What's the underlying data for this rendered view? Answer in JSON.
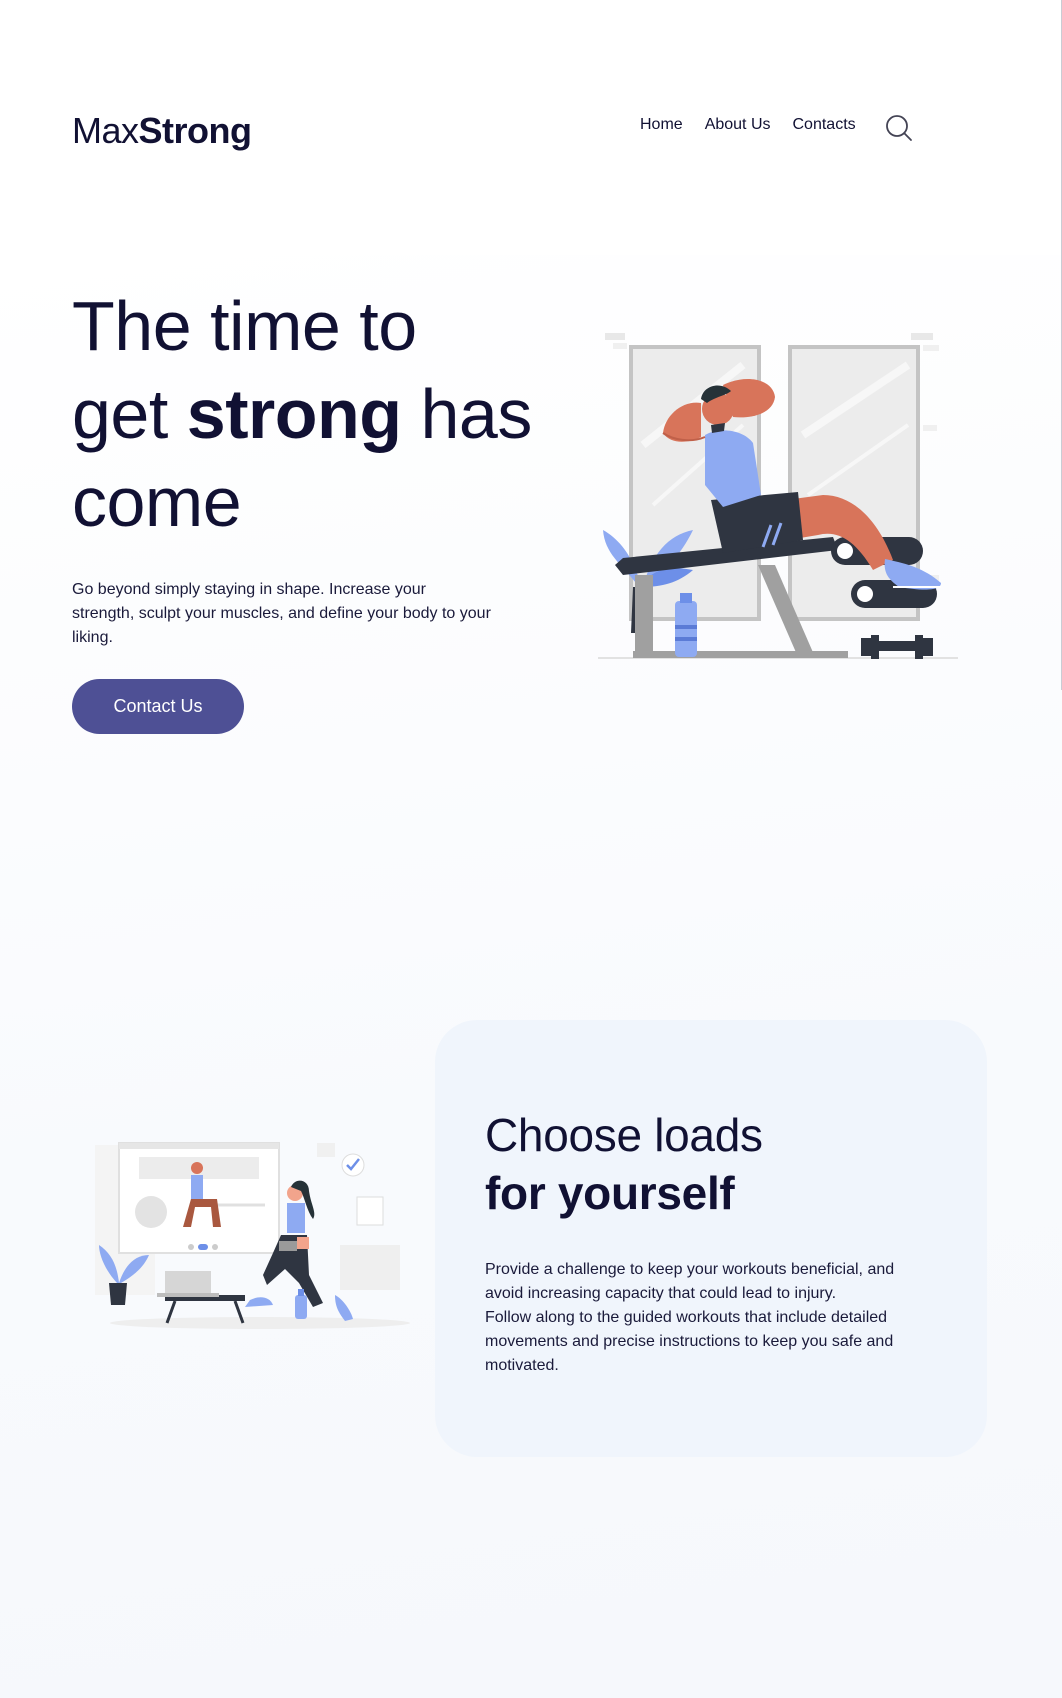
{
  "header": {
    "logo": {
      "part1": "Max",
      "part2": "Strong"
    },
    "nav": [
      {
        "label": "Home"
      },
      {
        "label": "About Us"
      },
      {
        "label": "Contacts"
      }
    ],
    "search_icon": "search-icon"
  },
  "hero": {
    "title_line1": "The time to",
    "title_line2_pre": "get ",
    "title_line2_bold": "strong",
    "title_line2_post": " has",
    "title_line3": "come",
    "description": "Go beyond simply staying in shape. Increase your strength, sculpt your muscles, and define your body to your liking.",
    "cta_label": "Contact Us"
  },
  "feature": {
    "title_line1": "Choose loads",
    "title_line2": "for yourself",
    "description_1": "Provide a challenge to keep your workouts beneficial, and avoid increasing capacity that could lead to injury.",
    "description_2": "Follow along to the guided workouts that include detailed movements and precise instructions to keep you safe and motivated."
  },
  "colors": {
    "accent": "#4e5095",
    "text_dark": "#111133",
    "card_bg": "#f0f5fc",
    "illustration_skin": "#d8745a",
    "illustration_blue": "#8eaaf2"
  }
}
